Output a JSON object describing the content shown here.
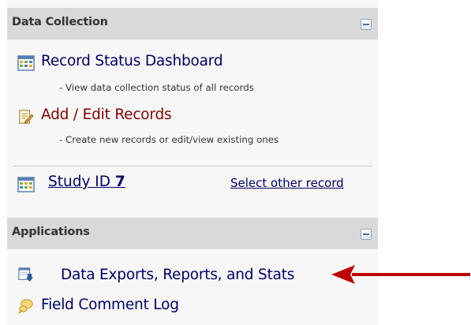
{
  "data_collection": {
    "title": "Data Collection",
    "items": [
      {
        "label": "Record Status Dashboard",
        "description": "- View data collection status of all records",
        "icon": "dashboard-table-icon"
      },
      {
        "label": "Add / Edit Records",
        "description": "- Create new records or edit/view existing ones",
        "icon": "edit-document-icon"
      }
    ],
    "record": {
      "label": "Study ID",
      "id": "7",
      "select_other": "Select other record"
    }
  },
  "applications": {
    "title": "Applications",
    "items": [
      {
        "label": "Data Exports, Reports, and Stats",
        "icon": "data-export-icon"
      },
      {
        "label": "Field Comment Log",
        "icon": "comment-bubble-icon"
      }
    ]
  },
  "colors": {
    "header_bg": "#d9d9d9",
    "panel_bg": "#f7f7f7",
    "link_blue": "#000066",
    "link_red": "#800000",
    "arrow": "#c00000"
  }
}
